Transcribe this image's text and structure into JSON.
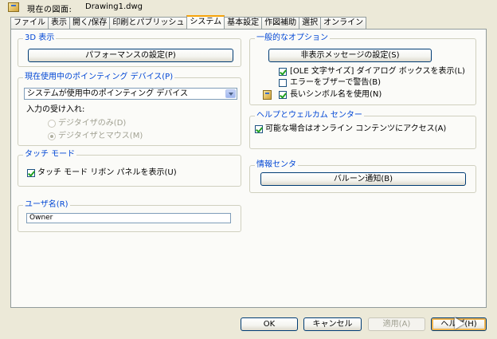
{
  "header": {
    "current_drawing_label": "現在の図面:",
    "current_drawing_value": "Drawing1.dwg"
  },
  "tabs": [
    {
      "label": "ファイル"
    },
    {
      "label": "表示"
    },
    {
      "label": "開く/保存"
    },
    {
      "label": "印刷とパブリッシュ"
    },
    {
      "label": "システム",
      "active": true
    },
    {
      "label": "基本設定"
    },
    {
      "label": "作図補助"
    },
    {
      "label": "選択"
    },
    {
      "label": "オンライン"
    }
  ],
  "graphics": {
    "title": "3D 表示",
    "button": "パフォーマンスの設定(P)"
  },
  "pointing": {
    "title": "現在使用中のポインティング デバイス(P)",
    "selected": "システムが使用中のポインティング デバイス",
    "accept_label": "入力の受け入れ:",
    "option_digitizer_only": "デジタイザのみ(D)",
    "option_digitizer_mouse": "デジタイザとマウス(M)"
  },
  "touch": {
    "title": "タッチ モード",
    "checkbox": "タッチ モード リボン パネルを表示(U)"
  },
  "user": {
    "title": "ユーザ名(R)",
    "value": "Owner"
  },
  "general": {
    "title": "一般的なオプション",
    "button": "非表示メッセージの設定(S)",
    "check_ole": "[OLE 文字サイズ] ダイアログ ボックスを表示(L)",
    "check_beep": "エラーをブザーで警告(B)",
    "check_long": "長いシンボル名を使用(N)"
  },
  "help": {
    "title": "ヘルプとウェルカム センター",
    "checkbox": "可能な場合はオンライン コンテンツにアクセス(A)"
  },
  "info": {
    "title": "情報センタ",
    "button": "バルーン通知(B)"
  },
  "footer": {
    "ok": "OK",
    "cancel": "キャンセル",
    "apply": "適用(A)",
    "help": "ヘルプ(H)"
  }
}
